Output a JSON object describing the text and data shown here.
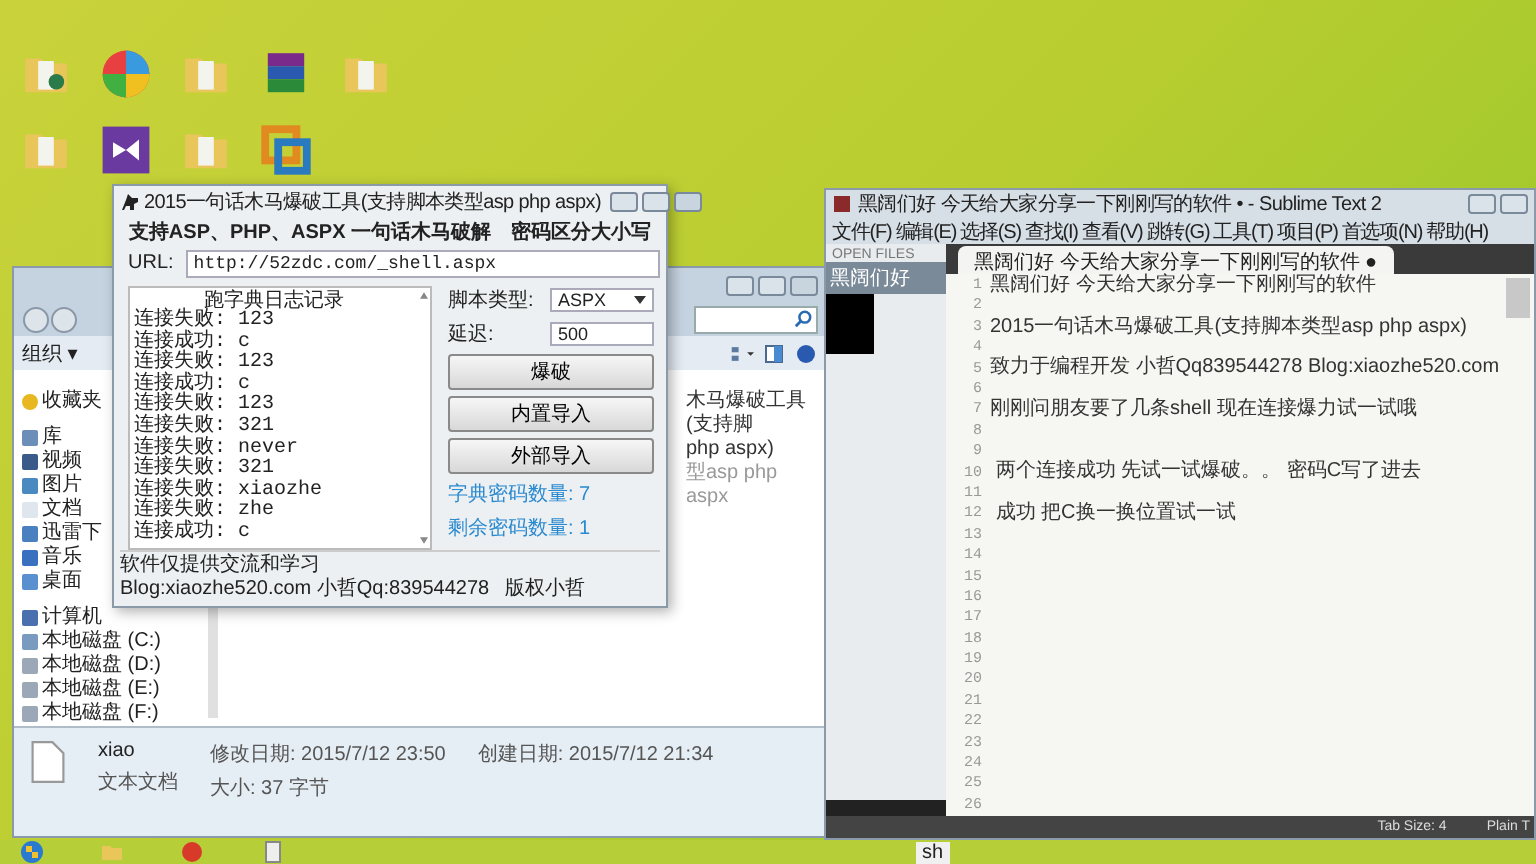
{
  "desktop": {
    "icons": [
      {
        "kind": "user-folder"
      },
      {
        "kind": "pinwheel"
      },
      {
        "kind": "folder"
      },
      {
        "kind": "archive"
      },
      {
        "kind": "folder"
      },
      {
        "kind": "folder"
      },
      {
        "kind": "studio"
      },
      {
        "kind": "folder"
      },
      {
        "kind": "vm"
      }
    ]
  },
  "explorer": {
    "toolbar": {
      "organize": "组织 ▾"
    },
    "sidebar": [
      {
        "kind": "star",
        "label": "收藏夹"
      },
      {
        "kind": "library",
        "label": "库",
        "children": [
          {
            "kind": "video",
            "label": "视频"
          },
          {
            "kind": "picture",
            "label": "图片"
          },
          {
            "kind": "doc",
            "label": "文档"
          },
          {
            "kind": "download",
            "label": "迅雷下"
          },
          {
            "kind": "music",
            "label": "音乐"
          },
          {
            "kind": "desk",
            "label": "桌面"
          }
        ]
      },
      {
        "kind": "computer",
        "label": "计算机",
        "children": [
          {
            "kind": "system-disk",
            "label": "本地磁盘 (C:)"
          },
          {
            "kind": "disk",
            "label": "本地磁盘 (D:)"
          },
          {
            "kind": "disk",
            "label": "本地磁盘 (E:)"
          },
          {
            "kind": "disk",
            "label": "本地磁盘 (F:)"
          }
        ]
      }
    ],
    "list": [
      "木马爆破工具(支持脚",
      "php aspx)",
      "型asp php aspx"
    ],
    "details": {
      "name": "xiao",
      "type": "文本文档",
      "modified": "修改日期: 2015/7/12 23:50",
      "size": "大小: 37 字节",
      "created": "创建日期: 2015/7/12 21:34"
    }
  },
  "tool": {
    "title": "2015一句话木马爆破工具(支持脚本类型asp php aspx)",
    "subtitle": "支持ASP、PHP、ASPX 一句话木马破解",
    "case_note": "密码区分大小写",
    "url_label": "URL:",
    "url": "http://52zdc.com/_shell.aspx",
    "log_heading": "跑字典日志记录",
    "log": [
      "连接失败: 123",
      "连接成功: c",
      "连接失败: 123",
      "连接成功: c",
      "连接失败: 123",
      "连接失败: 321",
      "连接失败: never",
      "连接失败: 321",
      "连接失败: xiaozhe",
      "连接失败: zhe",
      "连接成功: c"
    ],
    "script_label": "脚本类型:",
    "script_value": "ASPX",
    "delay_label": "延迟:",
    "delay_value": "500",
    "buttons": [
      "爆破",
      "内置导入",
      "外部导入"
    ],
    "counts": [
      "字典密码数量: 7",
      "剩余密码数量: 1"
    ],
    "status": [
      "软件仅提供交流和学习",
      "Blog:xiaozhe520.com 小哲Qq:839544278",
      "版权小哲"
    ]
  },
  "sublime": {
    "title": "黑阔们好 今天给大家分享一下刚刚写的软件 • - Sublime Text 2",
    "menu": [
      "文件(F)",
      "编辑(E)",
      "选择(S)",
      "查找(I)",
      "查看(V)",
      "跳转(G)",
      "工具(T)",
      "项目(P)",
      "首选项(N)",
      "帮助(H)"
    ],
    "sidebar_heading": "OPEN FILES",
    "open_file": "黑阔们好",
    "tab": "黑阔们好 今天给大家分享一下刚刚写的软件 ●",
    "lines": [
      {
        "number": "1",
        "text": "黑阔们好 今天给大家分享一下刚刚写的软件"
      },
      {
        "number": "2"
      },
      {
        "number": "3",
        "text": "2015一句话木马爆破工具(支持脚本类型asp php aspx)"
      },
      {
        "number": "4"
      },
      {
        "number": "5",
        "text": "致力于编程开发 小哲Qq839544278 Blog:xiaozhe520.com"
      },
      {
        "number": "6"
      },
      {
        "number": "7",
        "text": "刚刚问朋友要了几条shell 现在连接爆力试一试哦"
      },
      {
        "number": "8"
      },
      {
        "number": "9"
      },
      {
        "number": "10",
        "text": " 两个连接成功 先试一试爆破。。 密码C写了进去"
      },
      {
        "number": "11"
      },
      {
        "number": "12",
        "text": " 成功 把C换一换位置试一试"
      },
      {
        "number": "13"
      },
      {
        "number": "14"
      },
      {
        "number": "15"
      },
      {
        "number": "16"
      },
      {
        "number": "17"
      },
      {
        "number": "18"
      },
      {
        "number": "19"
      },
      {
        "number": "20"
      },
      {
        "number": "21"
      },
      {
        "number": "22"
      },
      {
        "number": "23"
      },
      {
        "number": "24"
      },
      {
        "number": "25"
      },
      {
        "number": "26"
      }
    ],
    "status": [
      "Tab Size: 4",
      "Plain T"
    ]
  },
  "taskbar": {
    "input": "sh"
  }
}
